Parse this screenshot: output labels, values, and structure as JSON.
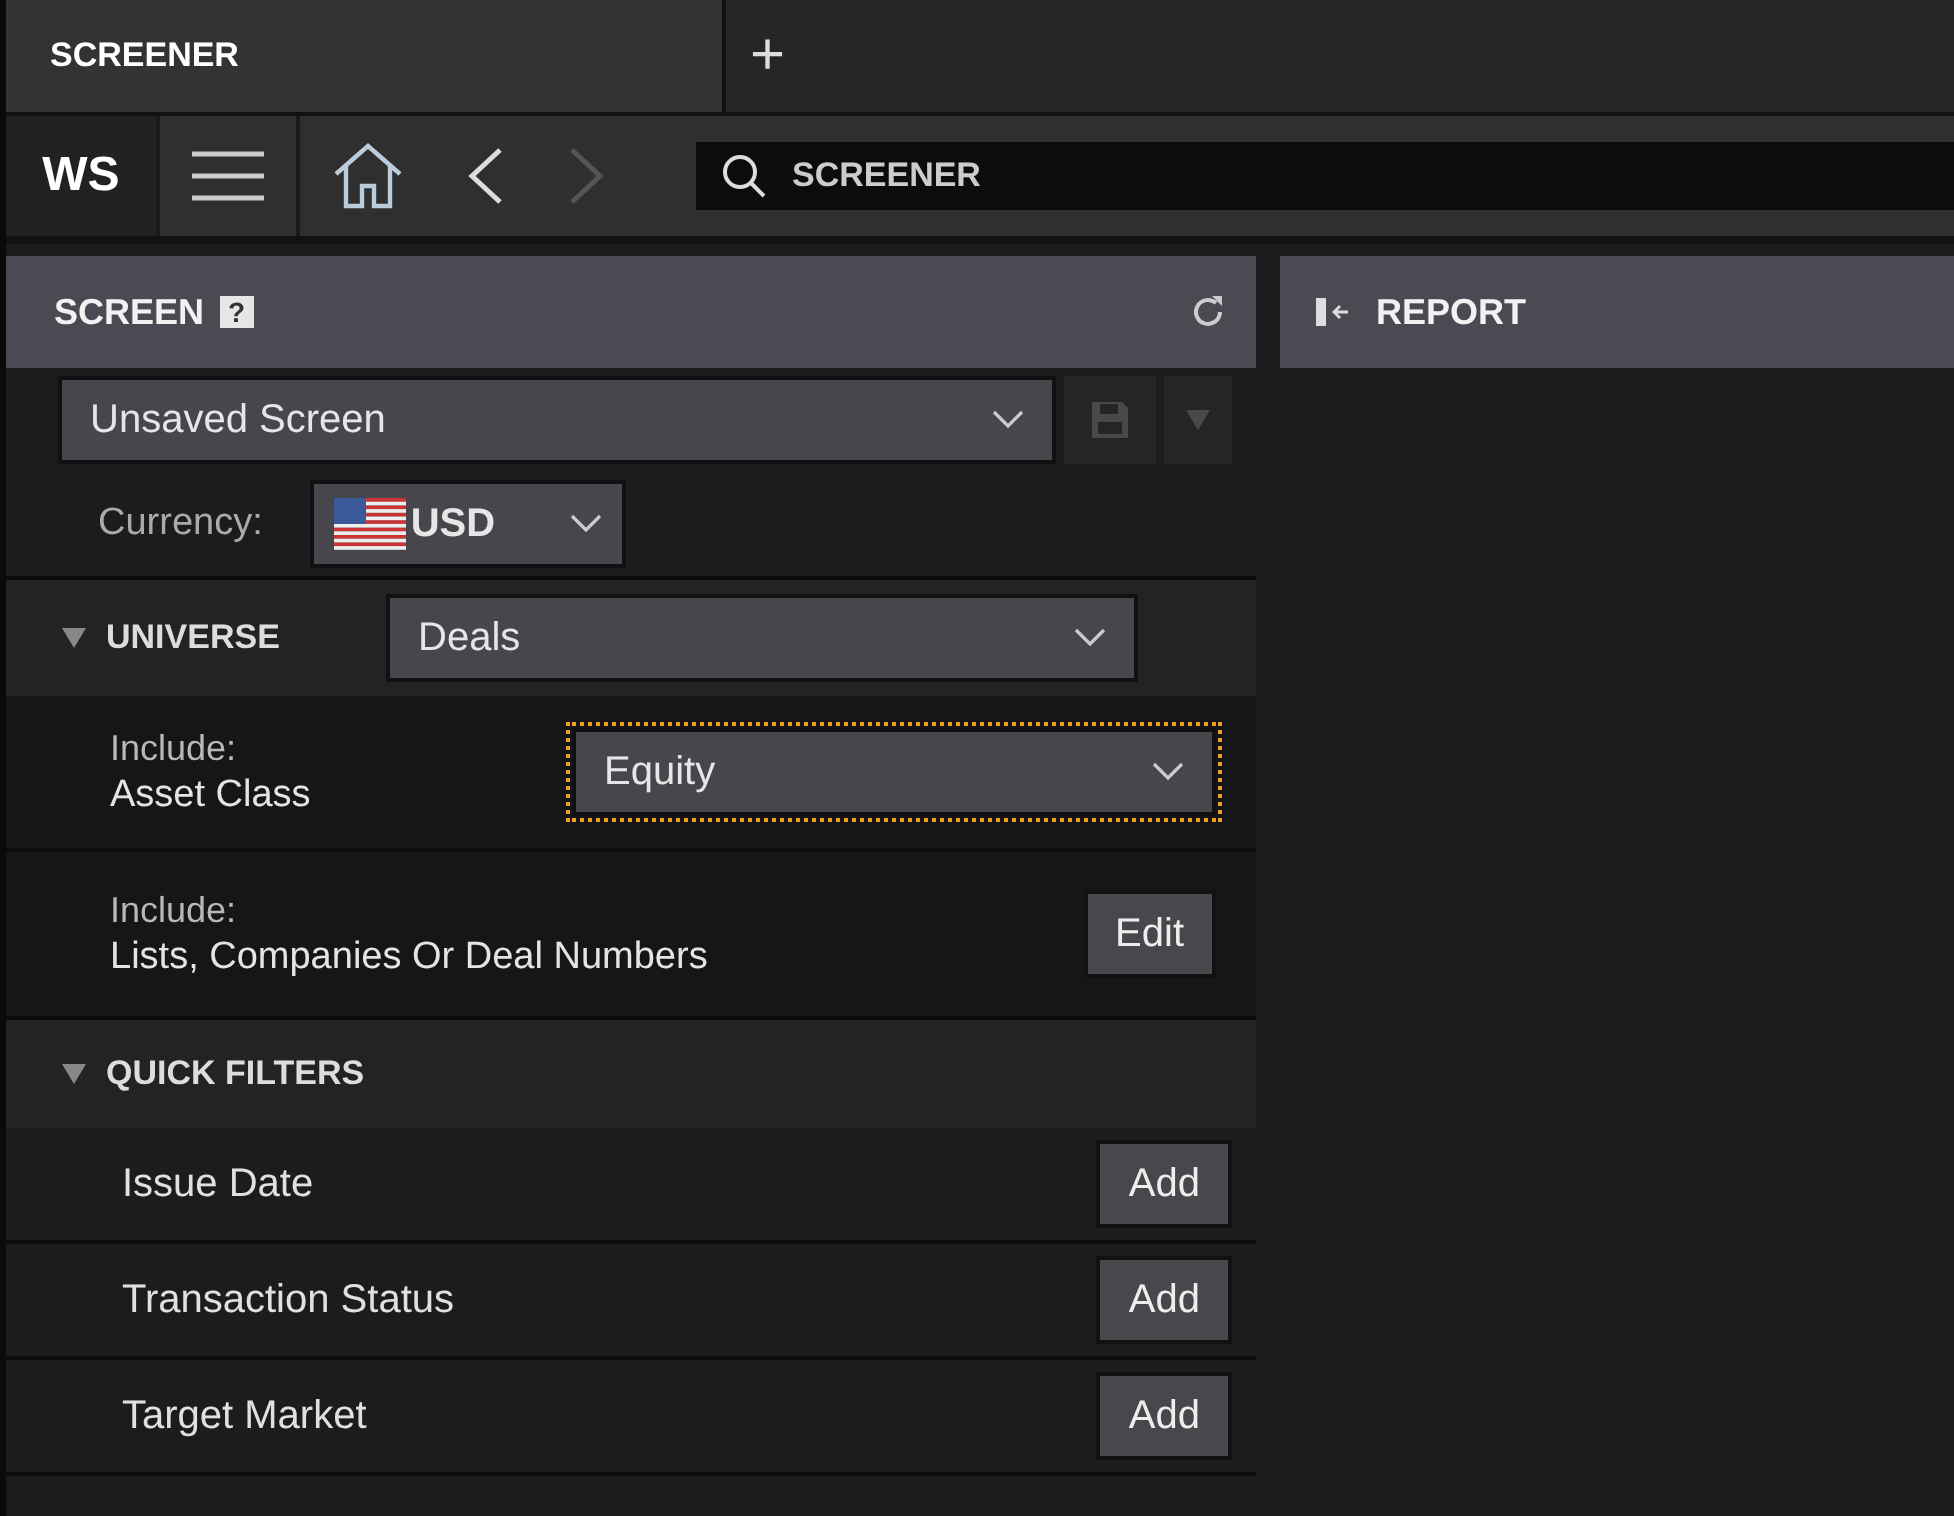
{
  "tabs": [
    {
      "label": "SCREENER",
      "selected": true
    }
  ],
  "new_tab": "+",
  "toolbar": {
    "logo": "WS",
    "back_disabled": false,
    "forward_disabled": true,
    "search": {
      "value": "SCREENER"
    }
  },
  "screen_panel": {
    "title": "SCREEN",
    "help": "?",
    "screen_select": "Unsaved Screen",
    "save_disabled": true,
    "currency_label": "Currency:",
    "currency": "USD",
    "universe": {
      "title": "UNIVERSE",
      "expanded": true,
      "value": "Deals",
      "rows": [
        {
          "kind": "select",
          "label_top": "Include:",
          "label": "Asset Class",
          "value": "Equity",
          "focused": true
        },
        {
          "kind": "button",
          "label_top": "Include:",
          "label": "Lists, Companies Or Deal Numbers",
          "button": "Edit"
        }
      ]
    },
    "quick_filters": {
      "title": "QUICK FILTERS",
      "expanded": true,
      "items": [
        {
          "label": "Issue Date",
          "button": "Add"
        },
        {
          "label": "Transaction Status",
          "button": "Add"
        },
        {
          "label": "Target Market",
          "button": "Add"
        }
      ]
    }
  },
  "report_panel": {
    "title": "REPORT"
  }
}
